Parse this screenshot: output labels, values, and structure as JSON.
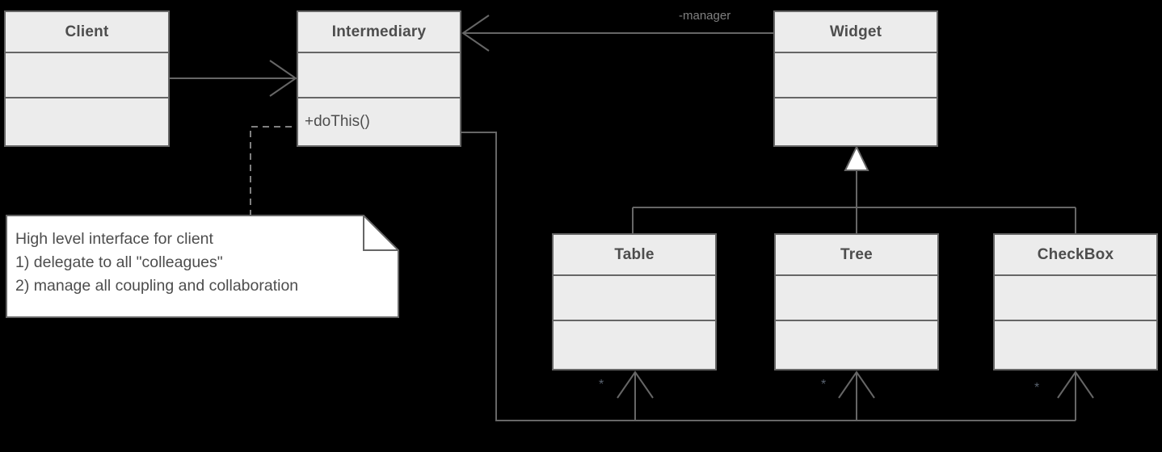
{
  "diagram": {
    "title": "Mediator pattern UML class diagram",
    "background": "#000000",
    "class_fill": "#ececec",
    "class_stroke": "#666666",
    "text_color": "#4d4d4d",
    "line_color": "#666666"
  },
  "classes": [
    {
      "id": "client",
      "name": "Client",
      "attributes": "",
      "operations": ""
    },
    {
      "id": "intermediary",
      "name": "Intermediary",
      "attributes": "",
      "operations": "+doThis()"
    },
    {
      "id": "widget",
      "name": "Widget",
      "attributes": "",
      "operations": ""
    },
    {
      "id": "table",
      "name": "Table",
      "attributes": "",
      "operations": ""
    },
    {
      "id": "tree",
      "name": "Tree",
      "attributes": "",
      "operations": ""
    },
    {
      "id": "checkbox",
      "name": "CheckBox",
      "attributes": "",
      "operations": ""
    }
  ],
  "note": {
    "line1": "High level interface for client",
    "line2": "1) delegate to all \"colleagues\"",
    "line3": "2) manage all coupling and collaboration"
  },
  "edge_labels": {
    "manager": "-manager",
    "table_multiplicity": "*",
    "tree_multiplicity": "*",
    "checkbox_multiplicity": "*"
  }
}
